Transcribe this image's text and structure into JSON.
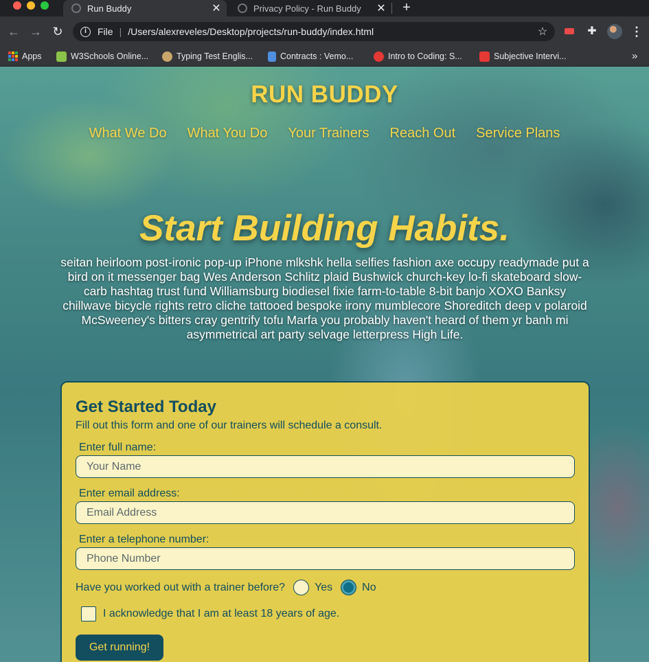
{
  "browser": {
    "tabs": [
      {
        "title": "Run Buddy",
        "active": true
      },
      {
        "title": "Privacy Policy - Run Buddy",
        "active": false
      }
    ],
    "address": {
      "scheme": "File",
      "url": "/Users/alexreveles/Desktop/projects/run-buddy/index.html"
    },
    "bookmarks": [
      {
        "label": "Apps",
        "icon": "apps-grid-icon"
      },
      {
        "label": "W3Schools Online...",
        "icon": "w3schools-icon",
        "color": "#8bc34a"
      },
      {
        "label": "Typing Test Englis...",
        "icon": "typing-test-icon",
        "color": "#c9a66b"
      },
      {
        "label": "Contracts : Vemo...",
        "icon": "vemo-icon",
        "color": "#4f8fe0"
      },
      {
        "label": "Intro to Coding: S...",
        "icon": "ga-icon",
        "color": "#e53935"
      },
      {
        "label": "Subjective Intervi...",
        "icon": "h-icon",
        "color": "#e53935"
      }
    ]
  },
  "site": {
    "brand": "RUN BUDDY",
    "nav": [
      "What We Do",
      "What You Do",
      "Your Trainers",
      "Reach Out",
      "Service Plans"
    ],
    "hero": {
      "title": "Start Building Habits.",
      "text": "seitan heirloom post-ironic pop-up iPhone mlkshk hella selfies fashion axe occupy readymade put a bird on it messenger bag Wes Anderson Schlitz plaid Bushwick church-key lo-fi skateboard slow-carb hashtag trust fund Williamsburg biodiesel fixie farm-to-table 8-bit banjo XOXO Banksy chillwave bicycle rights retro cliche tattooed bespoke irony mumblecore Shoreditch deep v polaroid McSweeney's bitters cray gentrify tofu Marfa you probably haven't heard of them yr banh mi asymmetrical art party selvage letterpress High Life."
    },
    "form": {
      "title": "Get Started Today",
      "subtitle": "Fill out this form and one of our trainers will schedule a consult.",
      "name_label": "Enter full name:",
      "name_placeholder": "Your Name",
      "email_label": "Enter email address:",
      "email_placeholder": "Email Address",
      "phone_label": "Enter a telephone number:",
      "phone_placeholder": "Phone Number",
      "trainer_question": "Have you worked out with a trainer before?",
      "yes_label": "Yes",
      "no_label": "No",
      "selected_answer": "No",
      "acknowledge": "I acknowledge that I am at least 18 years of age.",
      "submit": "Get running!"
    },
    "colors": {
      "accent": "#f6d44a",
      "dark": "#134e5e"
    }
  }
}
